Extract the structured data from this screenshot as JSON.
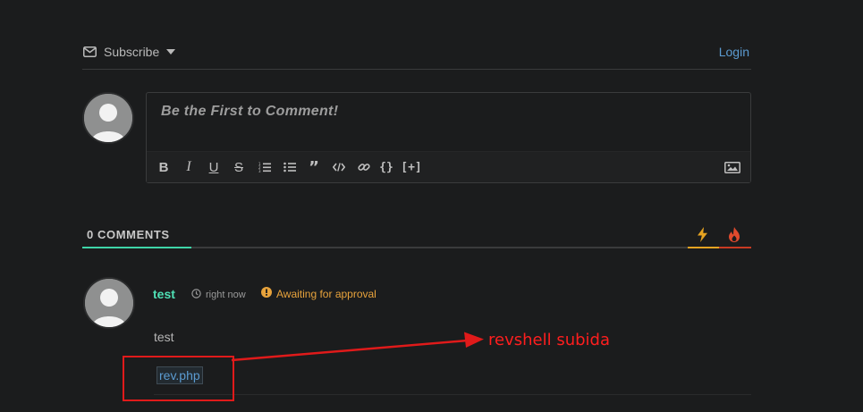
{
  "header": {
    "subscribe_label": "Subscribe",
    "login_label": "Login"
  },
  "editor": {
    "placeholder": "Be the First to Comment!",
    "toolbar_icons": [
      "bold-icon",
      "italic-icon",
      "underline-icon",
      "strikethrough-icon",
      "ordered-list-icon",
      "bullet-list-icon",
      "quote-icon",
      "code-icon",
      "link-icon",
      "code-block-icon",
      "spoiler-icon",
      "image-icon"
    ],
    "code_block_label": "{}",
    "spoiler_label": "[+]"
  },
  "comments": {
    "count_label": "0 COMMENTS",
    "sort_options": [
      "lightning-icon",
      "fire-icon"
    ],
    "items": [
      {
        "author": "test",
        "time": "right now",
        "status": "Awaiting for approval",
        "text": "test",
        "attachment": "rev.php"
      }
    ]
  },
  "annotation": {
    "text": "revshell subida",
    "color": "#ff1e1e"
  },
  "colors": {
    "accent": "#3ed5a8",
    "link": "#5b9bd1",
    "warning": "#e8a33c",
    "background": "#1b1c1d"
  }
}
